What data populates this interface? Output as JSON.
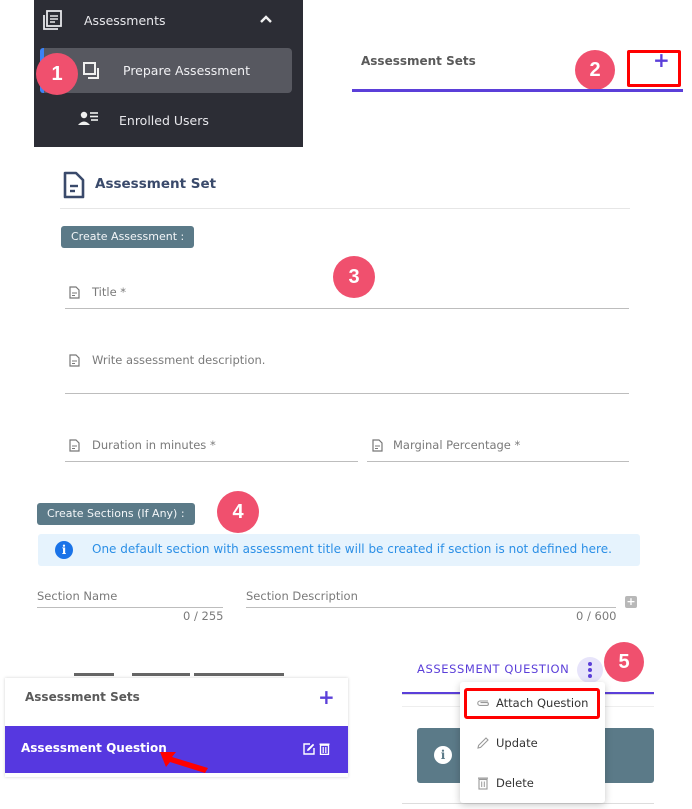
{
  "steps": [
    "1",
    "2",
    "3",
    "4",
    "5"
  ],
  "sidebar": {
    "section_label": "Assessments",
    "items": [
      {
        "label": "Prepare Assessment",
        "icon": "copy-icon",
        "active": true
      },
      {
        "label": "Enrolled Users",
        "icon": "user-list-icon",
        "active": false
      }
    ]
  },
  "assessment_sets_header": {
    "title": "Assessment Sets",
    "add_label": "+"
  },
  "form": {
    "heading": "Assessment Set",
    "create_assessment_chip": "Create Assessment :",
    "title_placeholder": "Title *",
    "description_placeholder": "Write assessment description.",
    "duration_placeholder": "Duration in minutes *",
    "marginal_placeholder": "Marginal Percentage *",
    "create_sections_chip": "Create Sections (If Any) :",
    "info_message": "One default section with assessment title will be created if section is not defined here.",
    "section_name_label": "Section Name",
    "section_name_count": "0 / 255",
    "section_desc_label": "Section Description",
    "section_desc_count": "0 / 600",
    "add_section_label": "+"
  },
  "sets_card": {
    "title": "Assessment Sets",
    "add_label": "+",
    "selected_item": "Assessment Question"
  },
  "question_panel": {
    "tab_label": "ASSESSMENT QUESTION",
    "menu": [
      {
        "label": "Attach Question",
        "icon": "paperclip-icon"
      },
      {
        "label": "Update",
        "icon": "pencil-icon"
      },
      {
        "label": "Delete",
        "icon": "trash-icon"
      }
    ]
  },
  "colors": {
    "accent": "#5b3fd9",
    "badge": "#f0506e",
    "highlight": "#ff0000",
    "chip": "#5b7a88",
    "info_text": "#2b8fe6"
  }
}
